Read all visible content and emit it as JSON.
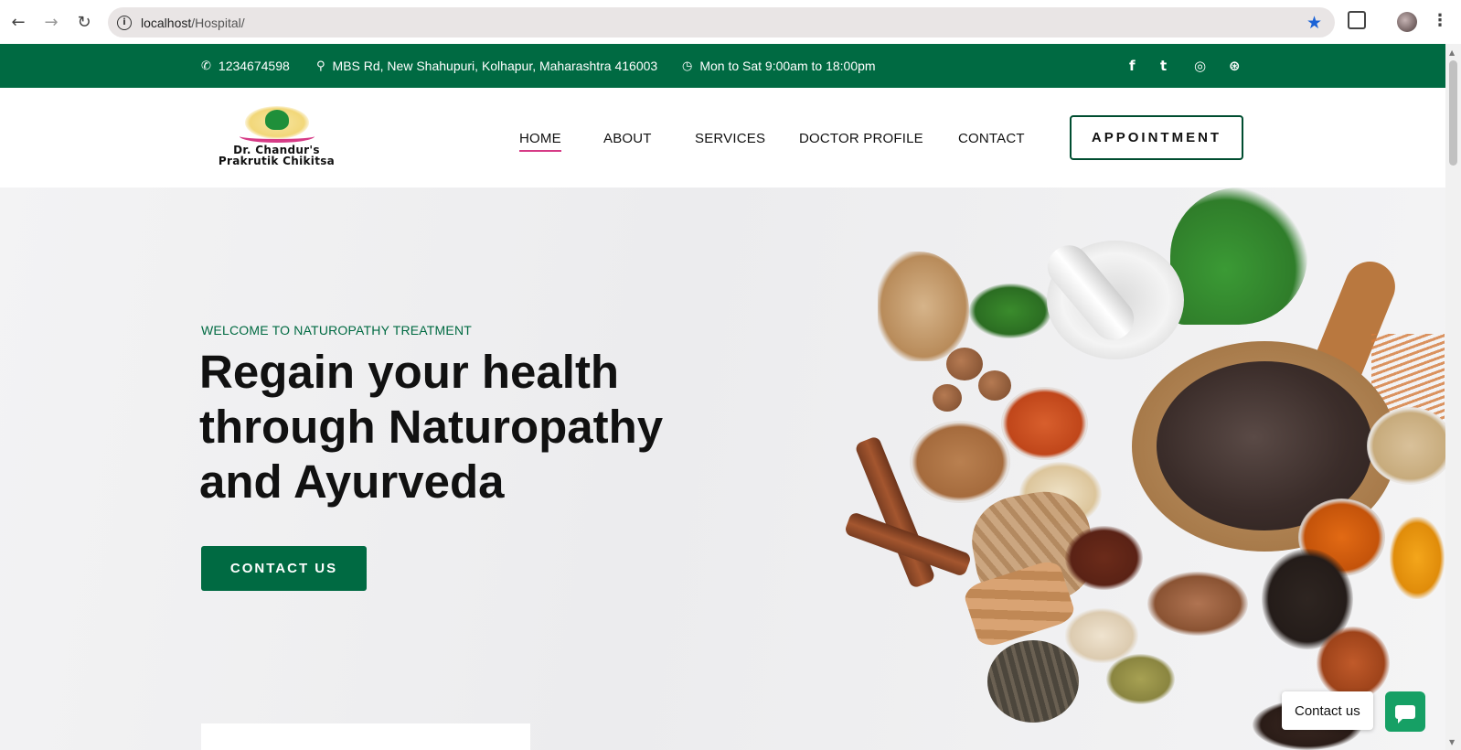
{
  "browser": {
    "url_host": "localhost",
    "url_path": "/Hospital/",
    "back_icon": "←",
    "forward_icon": "→",
    "reload_icon": "↻",
    "info_icon": "i",
    "star_icon": "★",
    "menu_icon": "⋮"
  },
  "topbar": {
    "phone_icon": "✆",
    "phone": "1234674598",
    "location_icon": "⚲",
    "address": "MBS Rd, New Shahupuri, Kolhapur, Maharashtra 416003",
    "clock_icon": "◷",
    "hours": "Mon to Sat 9:00am to 18:00pm",
    "social": {
      "facebook": "f",
      "twitter": "t",
      "instagram": "◎",
      "dribbble": "⊛"
    },
    "bg_color": "#006a42"
  },
  "header": {
    "logo_line1": "Dr. Chandur's",
    "logo_line2": "Prakrutik Chikitsa",
    "nav": [
      "HOME",
      "ABOUT",
      "SERVICES",
      "DOCTOR PROFILE",
      "CONTACT"
    ],
    "appointment": "APPOINTMENT",
    "active_color": "#d63b86"
  },
  "hero": {
    "subtitle": "WELCOME TO NATUROPATHY TREATMENT",
    "title_line1": "Regain your health",
    "title_line2": "through Naturopathy",
    "title_line3": "and Ayurveda",
    "cta": "CONTACT US"
  },
  "chat": {
    "label": "Contact us"
  }
}
